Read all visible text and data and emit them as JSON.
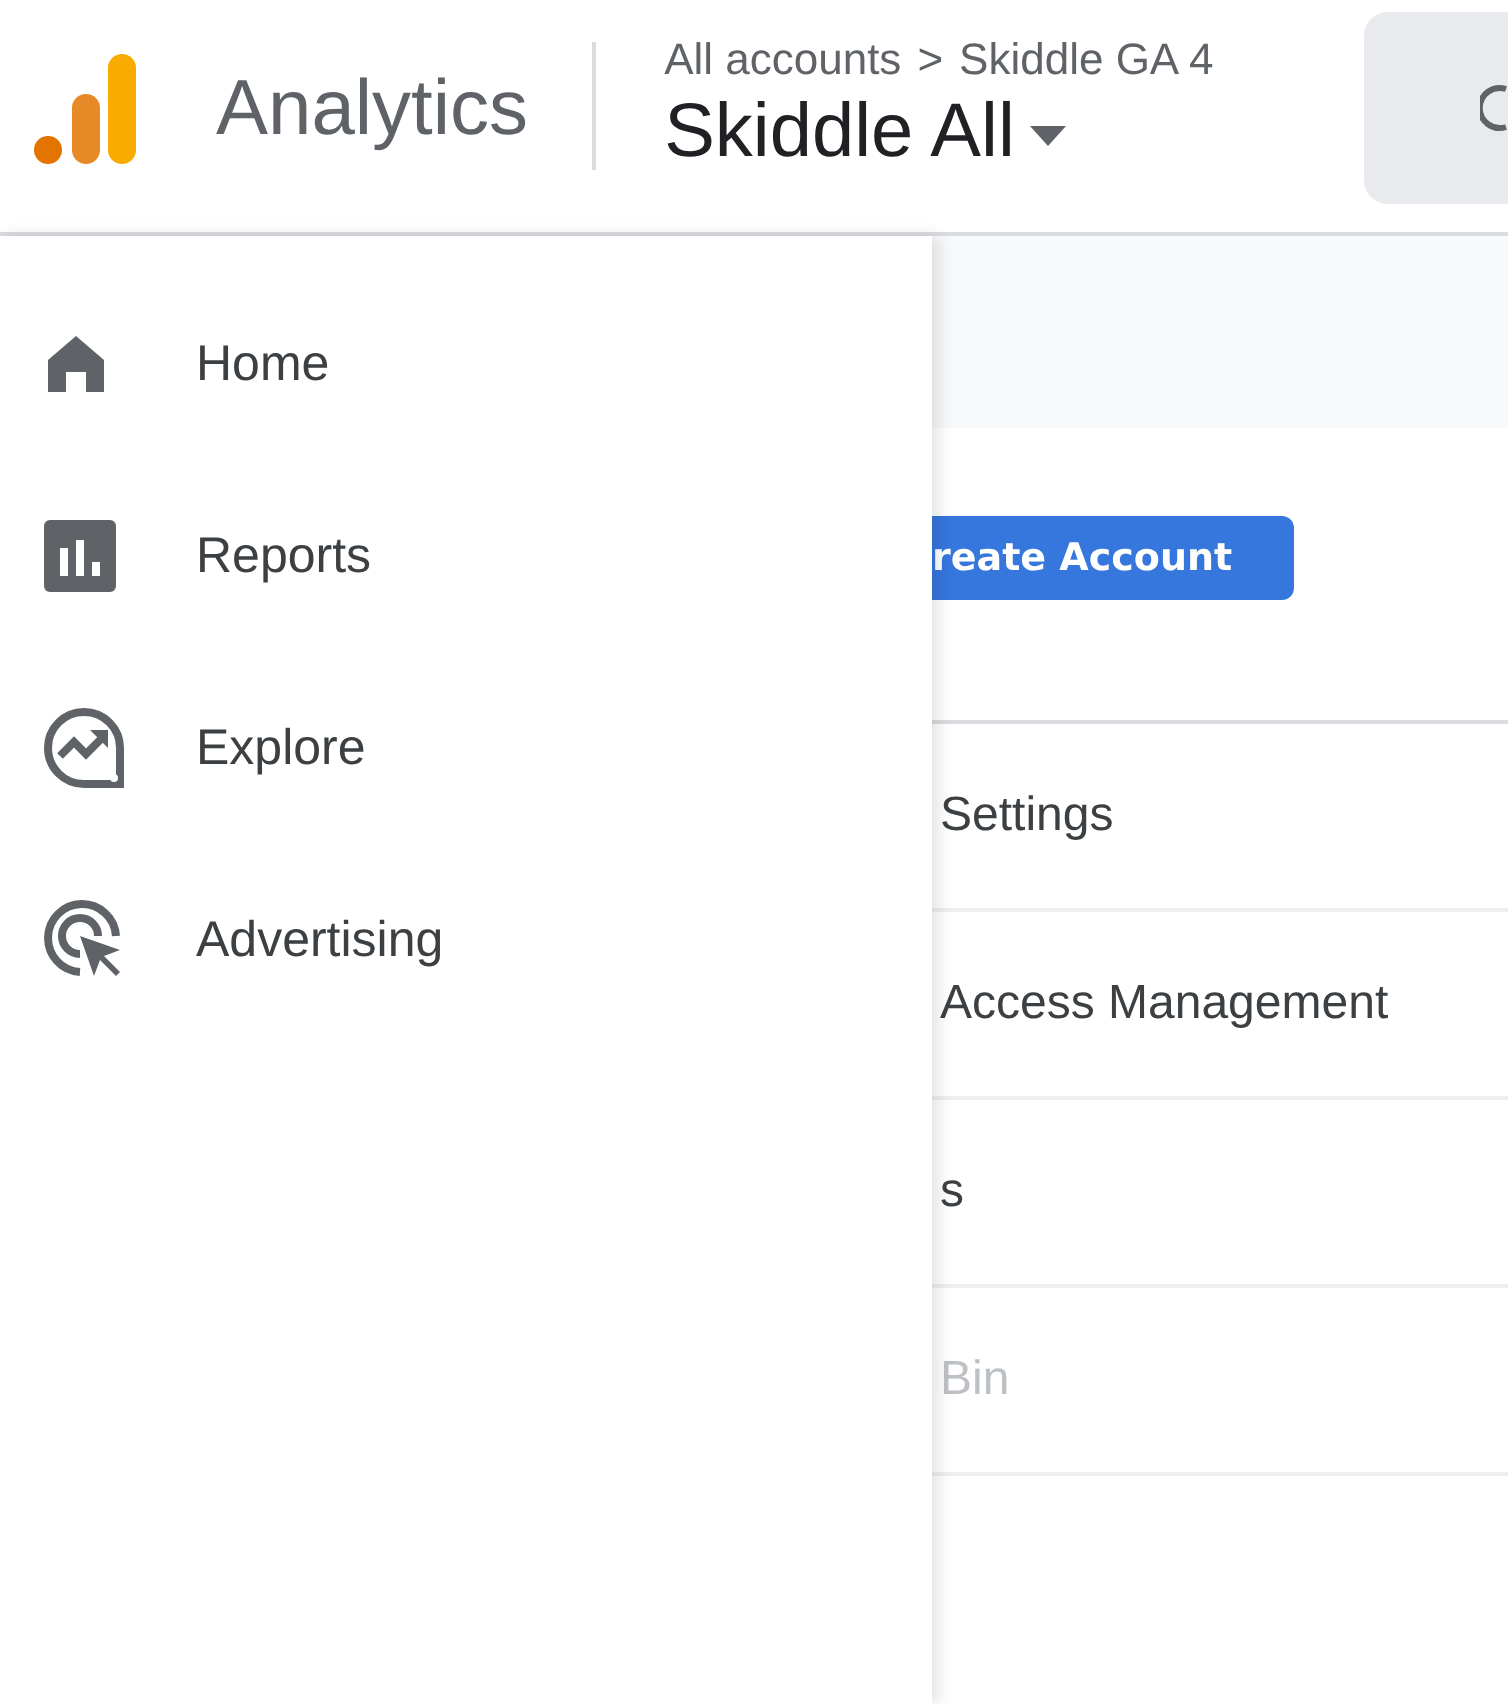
{
  "header": {
    "product": "Analytics",
    "breadcrumb": {
      "parent": "All accounts",
      "separator": ">",
      "current": "Skiddle GA 4"
    },
    "property": "Skiddle All"
  },
  "nav": [
    {
      "label": "Home"
    },
    {
      "label": "Reports"
    },
    {
      "label": "Explore"
    },
    {
      "label": "Advertising"
    }
  ],
  "content": {
    "button": "reate Account",
    "rows": [
      {
        "label": "Settings",
        "disabled": false
      },
      {
        "label": "Access Management",
        "disabled": false
      },
      {
        "label": "s",
        "disabled": false
      },
      {
        "label": "Bin",
        "disabled": true
      }
    ]
  }
}
